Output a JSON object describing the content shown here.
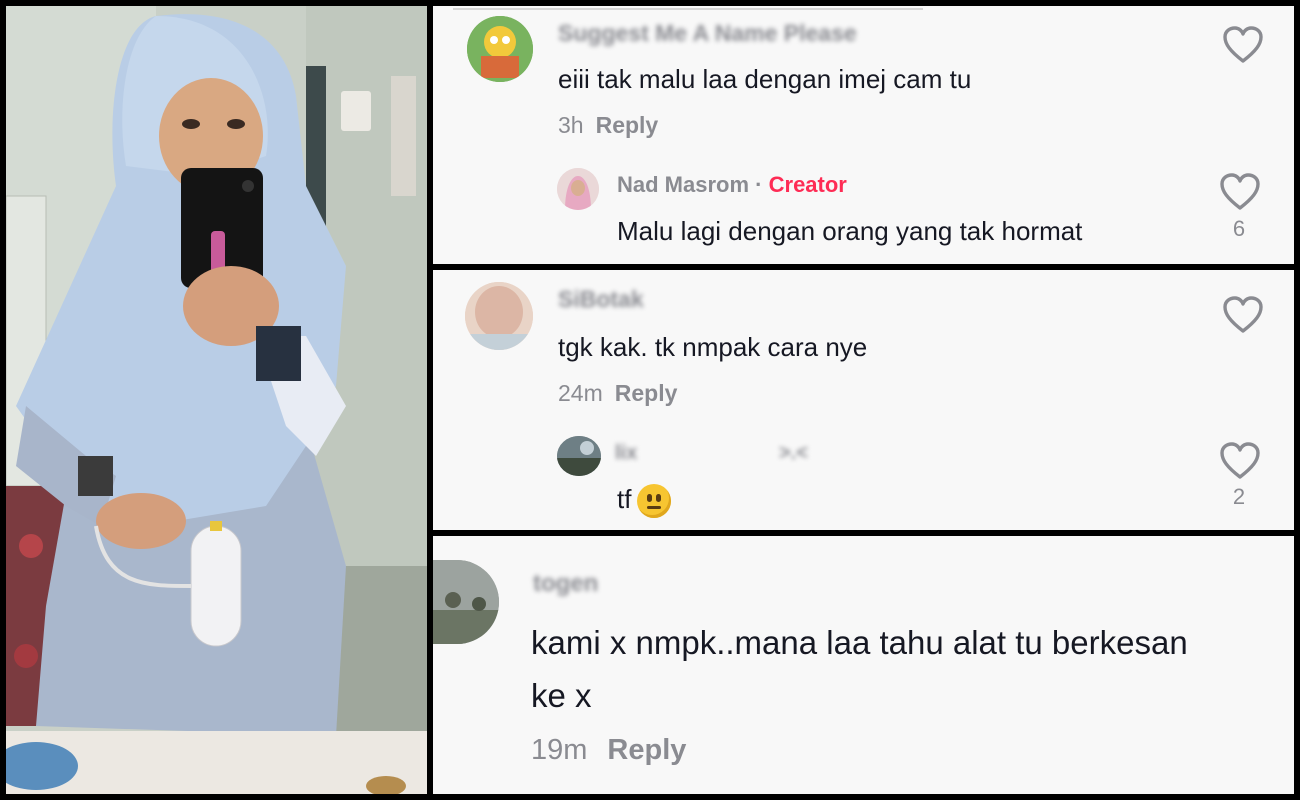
{
  "comments": [
    {
      "username": "Suggest Me A Name Please",
      "text": "eiii tak malu laa dengan imej cam tu",
      "time": "3h",
      "reply_label": "Reply",
      "reply": {
        "username": "Nad Masrom",
        "separator": "·",
        "badge": "Creator",
        "text": "Malu lagi dengan orang yang tak hormat",
        "likes": "6"
      }
    },
    {
      "username": "SiBotak",
      "text": "tgk kak. tk nmpak cara nye",
      "time": "24m",
      "reply_label": "Reply",
      "reply": {
        "username": "lix",
        "extra": ">.<",
        "text": "tf",
        "emoji": "neutral-face-icon",
        "likes": "2"
      }
    },
    {
      "username": "togen",
      "text_line1": "kami x nmpk..mana laa tahu alat tu berkesan",
      "text_line2": "ke x",
      "time": "19m",
      "reply_label": "Reply"
    }
  ],
  "colors": {
    "creator_badge": "#fe2c55",
    "muted_text": "#8a8b91",
    "panel_bg": "#f8f8f8"
  }
}
